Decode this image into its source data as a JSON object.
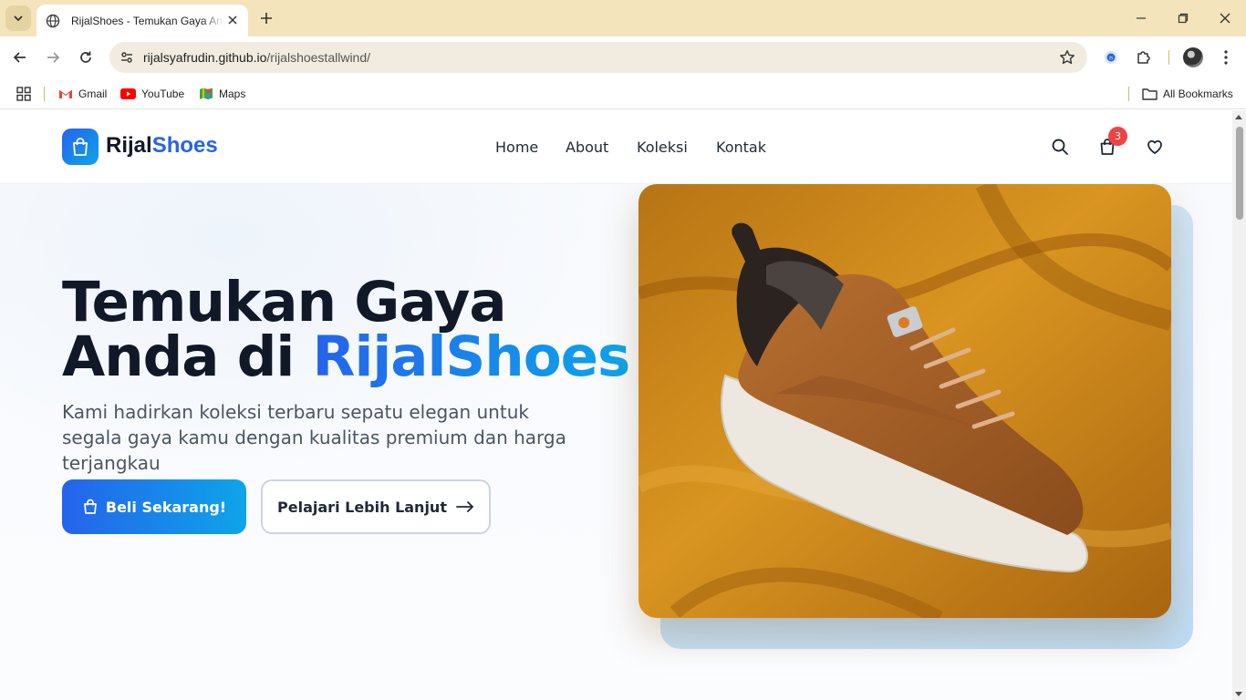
{
  "browser": {
    "tab_title": "RijalShoes - Temukan Gaya Anda di RijalShoes",
    "url_host": "rijalsyafrudin.github.io",
    "url_path": "/rijalshoestallwind/",
    "bookmarks": [
      {
        "label": "Gmail",
        "icon": "gmail-icon"
      },
      {
        "label": "YouTube",
        "icon": "youtube-icon"
      },
      {
        "label": "Maps",
        "icon": "maps-icon"
      }
    ],
    "all_bookmarks_label": "All Bookmarks"
  },
  "site": {
    "logo_main": "Rijal",
    "logo_accent": "Shoes",
    "menu": [
      "Home",
      "About",
      "Koleksi",
      "Kontak"
    ],
    "cart_count": "3"
  },
  "hero": {
    "title_line1": "Temukan Gaya",
    "title_line2_prefix": "Anda di ",
    "title_line2_accent": "RijalShoes",
    "subtitle": "Kami hadirkan koleksi terbaru sepatu elegan untuk segala gaya kamu dengan kualitas premium dan harga terjangkau",
    "cta_primary": "Beli Sekarang!",
    "cta_secondary": "Pelajari Lebih Lanjut"
  },
  "colors": {
    "accent": "#2563eb",
    "accent_light": "#0ea5e9",
    "badge": "#ef4444",
    "chrome_tabbar": "#f3e4bc"
  }
}
